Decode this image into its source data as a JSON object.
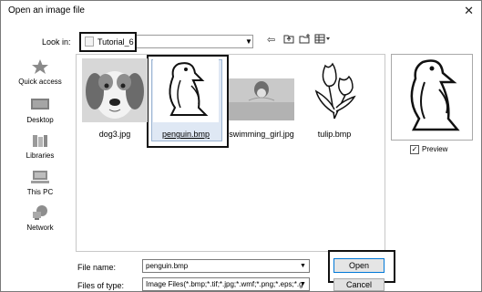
{
  "window": {
    "title": "Open an image file",
    "close_glyph": "✕"
  },
  "look_in": {
    "label": "Look in:",
    "folder": "Tutorial_6"
  },
  "toolbar": [
    "back-icon",
    "up-folder-icon",
    "new-folder-icon",
    "view-menu-icon"
  ],
  "places": [
    {
      "label": "Quick access",
      "icon": "star-icon"
    },
    {
      "label": "Desktop",
      "icon": "desktop-icon"
    },
    {
      "label": "Libraries",
      "icon": "libraries-icon"
    },
    {
      "label": "This PC",
      "icon": "computer-icon"
    },
    {
      "label": "Network",
      "icon": "network-icon"
    }
  ],
  "files": [
    {
      "name": "dog3.jpg",
      "selected": false
    },
    {
      "name": "penguin.bmp",
      "selected": true
    },
    {
      "name": "swimming_girl.jpg",
      "selected": false
    },
    {
      "name": "tulip.bmp",
      "selected": false
    }
  ],
  "preview": {
    "label": "Preview",
    "checked": true
  },
  "file_name": {
    "label": "File name:",
    "value": "penguin.bmp"
  },
  "file_type": {
    "label": "Files of type:",
    "value": "Image Files(*.bmp;*.tif;*.jpg;*.wmf;*.png;*.eps;*.g"
  },
  "buttons": {
    "open": "Open",
    "cancel": "Cancel"
  }
}
